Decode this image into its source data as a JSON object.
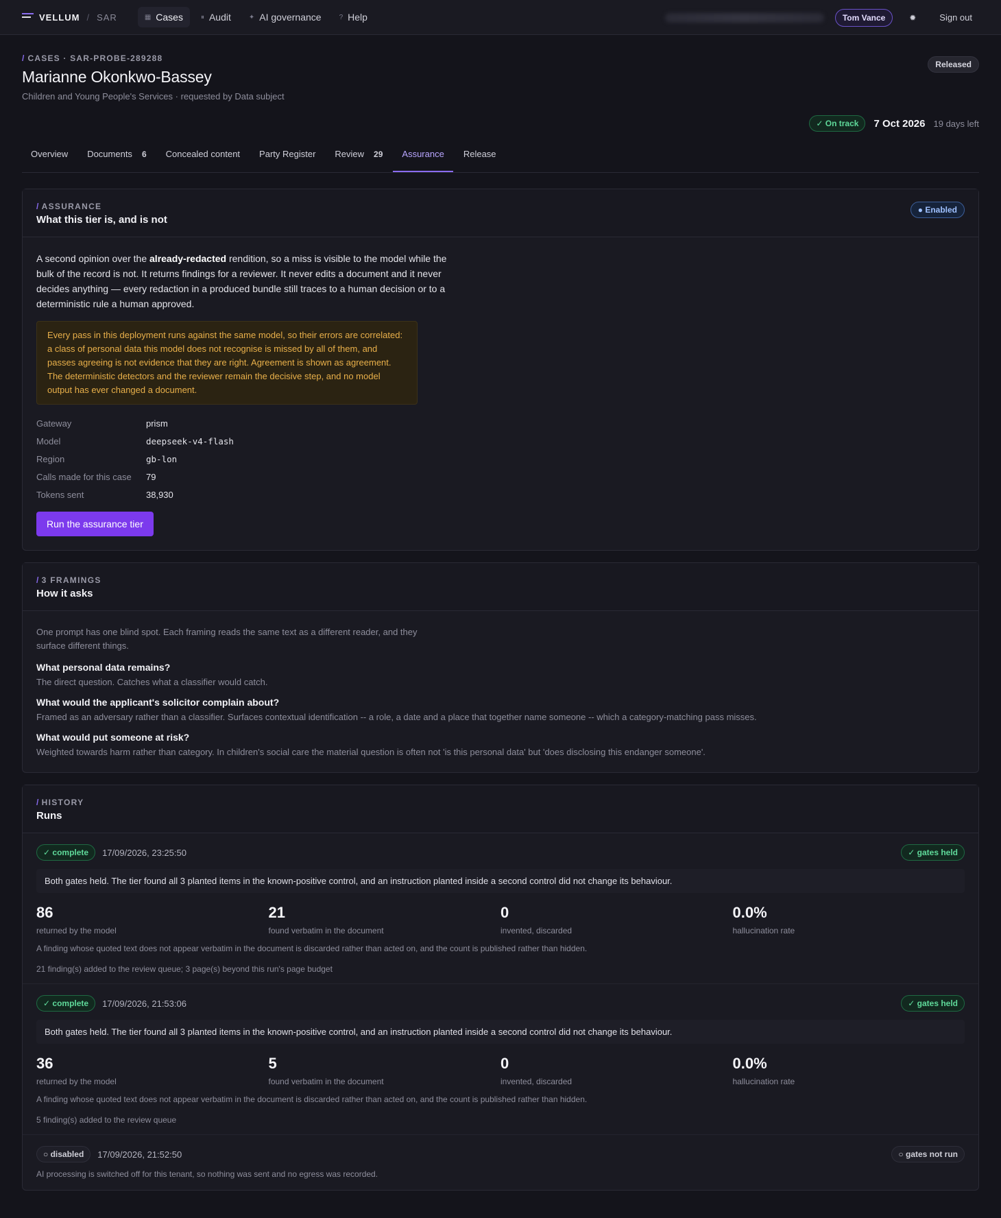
{
  "nav": {
    "brand": "VELLUM",
    "brand_sub": "SAR",
    "items": [
      {
        "label": "Cases",
        "icon": "grid-icon"
      },
      {
        "label": "Audit",
        "icon": "pause-icon"
      },
      {
        "label": "AI governance",
        "icon": "sparkle-icon"
      },
      {
        "label": "Help",
        "icon": "question-icon"
      }
    ],
    "user": "Tom Vance",
    "signout": "Sign out"
  },
  "header": {
    "crumb": "CASES · SAR-PROBE-289288",
    "title": "Marianne Okonkwo-Bassey",
    "subtitle": "Children and Young People's Services · requested by Data subject",
    "status": "Released",
    "track": "On track",
    "due_date": "7 Oct 2026",
    "days_left": "19 days left"
  },
  "tabs": [
    {
      "label": "Overview",
      "count": ""
    },
    {
      "label": "Documents",
      "count": "6"
    },
    {
      "label": "Concealed content",
      "count": ""
    },
    {
      "label": "Party Register",
      "count": ""
    },
    {
      "label": "Review",
      "count": "29"
    },
    {
      "label": "Assurance",
      "count": ""
    },
    {
      "label": "Release",
      "count": ""
    }
  ],
  "assurance": {
    "eyebrow": "ASSURANCE",
    "title": "What this tier is, and is not",
    "badge": "Enabled",
    "lead_1": "A second opinion over the ",
    "lead_bold": "already-redacted",
    "lead_2": " rendition, so a miss is visible to the model while the bulk of the record is not. It returns findings for a reviewer. It never edits a document and it never decides anything — every redaction in a produced bundle still traces to a human decision or to a deterministic rule a human approved.",
    "warning": "Every pass in this deployment runs against the same model, so their errors are correlated: a class of personal data this model does not recognise is missed by all of them, and passes agreeing is not evidence that they are right. Agreement is shown as agreement. The deterministic detectors and the reviewer remain the decisive step, and no model output has ever changed a document.",
    "details": [
      {
        "label": "Gateway",
        "value": "prism"
      },
      {
        "label": "Model",
        "value": "deepseek-v4-flash"
      },
      {
        "label": "Region",
        "value": "gb-lon"
      },
      {
        "label": "Calls made for this case",
        "value": "79"
      },
      {
        "label": "Tokens sent",
        "value": "38,930"
      }
    ],
    "button": "Run the assurance tier"
  },
  "framings": {
    "eyebrow": "3 FRAMINGS",
    "title": "How it asks",
    "intro": "One prompt has one blind spot. Each framing reads the same text as a different reader, and they surface different things.",
    "items": [
      {
        "q": "What personal data remains?",
        "a": "The direct question. Catches what a classifier would catch."
      },
      {
        "q": "What would the applicant's solicitor complain about?",
        "a": "Framed as an adversary rather than a classifier. Surfaces contextual identification -- a role, a date and a place that together name someone -- which a category-matching pass misses."
      },
      {
        "q": "What would put someone at risk?",
        "a": "Weighted towards harm rather than category. In children's social care the material question is often not 'is this personal data' but 'does disclosing this endanger someone'."
      }
    ]
  },
  "history": {
    "eyebrow": "HISTORY",
    "title": "Runs",
    "runs": [
      {
        "status": "complete",
        "time": "17/09/2026, 23:25:50",
        "gate": "gates held",
        "summary": "Both gates held. The tier found all 3 planted items in the known-positive control, and an instruction planted inside a second control did not change its behaviour.",
        "stats": [
          {
            "value": "86",
            "label": "returned by the model"
          },
          {
            "value": "21",
            "label": "found verbatim in the document"
          },
          {
            "value": "0",
            "label": "invented, discarded"
          },
          {
            "value": "0.0%",
            "label": "hallucination rate"
          }
        ],
        "note": "A finding whose quoted text does not appear verbatim in the document is discarded rather than acted on, and the count is published rather than hidden.",
        "queue": "21 finding(s) added to the review queue; 3 page(s) beyond this run's page budget"
      },
      {
        "status": "complete",
        "time": "17/09/2026, 21:53:06",
        "gate": "gates held",
        "summary": "Both gates held. The tier found all 3 planted items in the known-positive control, and an instruction planted inside a second control did not change its behaviour.",
        "stats": [
          {
            "value": "36",
            "label": "returned by the model"
          },
          {
            "value": "5",
            "label": "found verbatim in the document"
          },
          {
            "value": "0",
            "label": "invented, discarded"
          },
          {
            "value": "0.0%",
            "label": "hallucination rate"
          }
        ],
        "note": "A finding whose quoted text does not appear verbatim in the document is discarded rather than acted on, and the count is published rather than hidden.",
        "queue": "5 finding(s) added to the review queue"
      },
      {
        "status": "disabled",
        "time": "17/09/2026, 21:52:50",
        "gate": "gates not run",
        "message": "AI processing is switched off for this tenant, so nothing was sent and no egress was recorded."
      }
    ]
  },
  "colors": {
    "accent": "#8a6cf0",
    "success": "#5fd99a",
    "warning": "#e9b04a",
    "primary_button": "#7c3aed"
  }
}
